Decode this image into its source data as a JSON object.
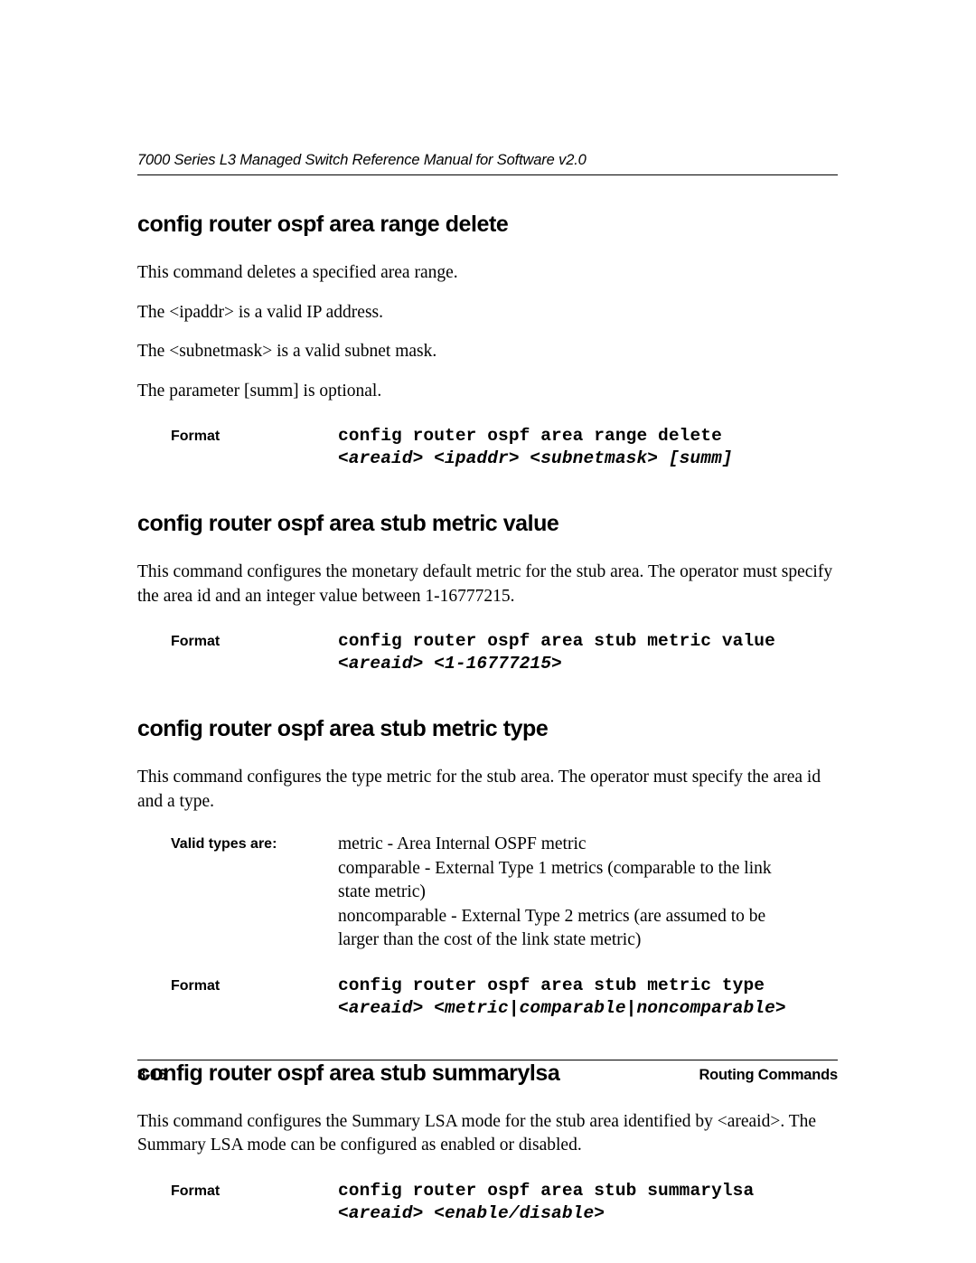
{
  "header": {
    "running_title": "7000 Series L3 Managed Switch Reference Manual for Software v2.0"
  },
  "sections": [
    {
      "heading": "config router ospf area range delete",
      "paragraphs": [
        "This command deletes a specified area range.",
        "The <ipaddr> is a valid IP address.",
        "The <subnetmask> is a valid subnet mask.",
        "The parameter [summ] is optional."
      ],
      "format": {
        "label": "Format",
        "command": "config router ospf area range delete",
        "args": "<areaid> <ipaddr> <subnetmask> [summ]"
      }
    },
    {
      "heading": "config router ospf area stub metric value",
      "paragraphs": [
        "This command configures the monetary default metric for the stub area. The operator must specify the area id and an integer value between 1-16777215."
      ],
      "format": {
        "label": "Format",
        "command": "config router ospf area stub metric value",
        "args": "<areaid> <1-16777215>"
      }
    },
    {
      "heading": "config router ospf area stub metric type",
      "paragraphs": [
        "This command configures the type metric for the stub area. The operator must specify the area id and a type."
      ],
      "valid_types": {
        "label": "Valid types are:",
        "items": [
          "metric - Area Internal OSPF metric",
          "comparable - External Type 1 metrics (comparable to the link state metric)",
          "noncomparable - External Type 2 metrics (are assumed to be larger than the cost of the link state metric)"
        ]
      },
      "format": {
        "label": "Format",
        "command": "config router ospf area stub metric type",
        "args": "<areaid> <metric|comparable|noncomparable>"
      }
    },
    {
      "heading": "config router ospf area stub summarylsa",
      "paragraphs": [
        "This command configures the Summary LSA mode for the stub area identified by <areaid>. The Summary LSA mode can be configured as enabled or disabled."
      ],
      "format": {
        "label": "Format",
        "command": "config router ospf area stub summarylsa",
        "args": "<areaid> <enable/disable>"
      }
    }
  ],
  "footer": {
    "page_number": "8-16",
    "chapter_title": "Routing Commands"
  }
}
